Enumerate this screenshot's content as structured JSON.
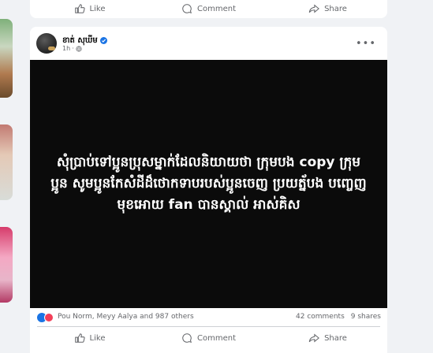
{
  "top_card": {
    "actions": [
      {
        "label": "Like",
        "icon": "like-icon"
      },
      {
        "label": "Comment",
        "icon": "comment-icon"
      },
      {
        "label": "Share",
        "icon": "share-icon"
      }
    ]
  },
  "post": {
    "author": "ខាត់ សុឃីម",
    "time": "1h",
    "privacy_icon": "globe-icon",
    "verified": true,
    "image_text": "សុំប្រាប់ទៅប្អូនប្រុសម្នាក់ដែលនិយាយថា ក្រុមបង copy ក្រុមប្អូន សូមប្អូនកែសំដីដ៏ថោកទាបរបស់ប្អូនចេញ ប្រយត្ន័បង បញ្ចេញមុខអោយ fan បានស្គាល់ អាស់គិស",
    "reactions_text": "Pou Norm, Meyy Aalya and 987 others",
    "comments": "42 comments",
    "shares": "9 shares",
    "actions": [
      {
        "label": "Like",
        "icon": "like-icon"
      },
      {
        "label": "Comment",
        "icon": "comment-icon"
      },
      {
        "label": "Share",
        "icon": "share-icon"
      }
    ]
  },
  "colors": {
    "background": "#f0f2f5",
    "card": "#ffffff",
    "secondary_text": "#65676b",
    "verified_blue": "#1b74e4",
    "image_background": "#0b0b0b"
  }
}
